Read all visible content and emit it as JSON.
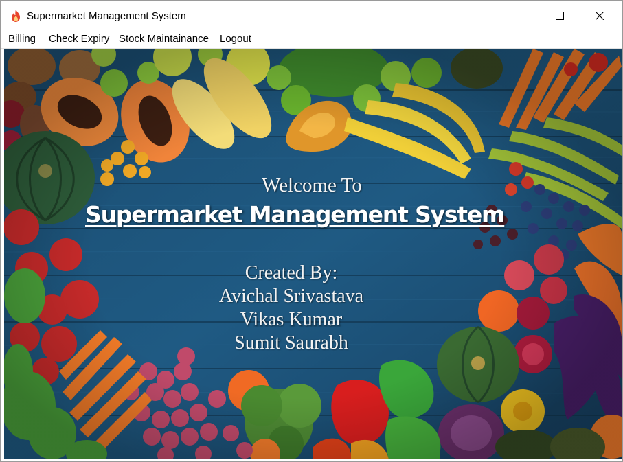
{
  "window": {
    "title": "Supermarket Management System",
    "icon": "flame-icon",
    "controls": [
      "minimize-icon",
      "maximize-icon",
      "close-icon"
    ]
  },
  "menu": {
    "items": [
      {
        "label": "Billing"
      },
      {
        "label": "Check Expiry"
      },
      {
        "label": "Stock Maintainance"
      },
      {
        "label": "Logout"
      }
    ]
  },
  "splash": {
    "welcome": "Welcome To",
    "headline": "Supermarket Management System",
    "created_by": "Created By:",
    "authors": [
      "Avichal Srivastava",
      "Vikas Kumar",
      "Sumit Saurabh"
    ],
    "background": "fruits-and-vegetables-on-blue-wooden-table"
  },
  "colors": {
    "wood": "#1d4f74",
    "wood_dark": "#153d5c",
    "text": "#f4f4f4",
    "flame": "#e8452c"
  }
}
